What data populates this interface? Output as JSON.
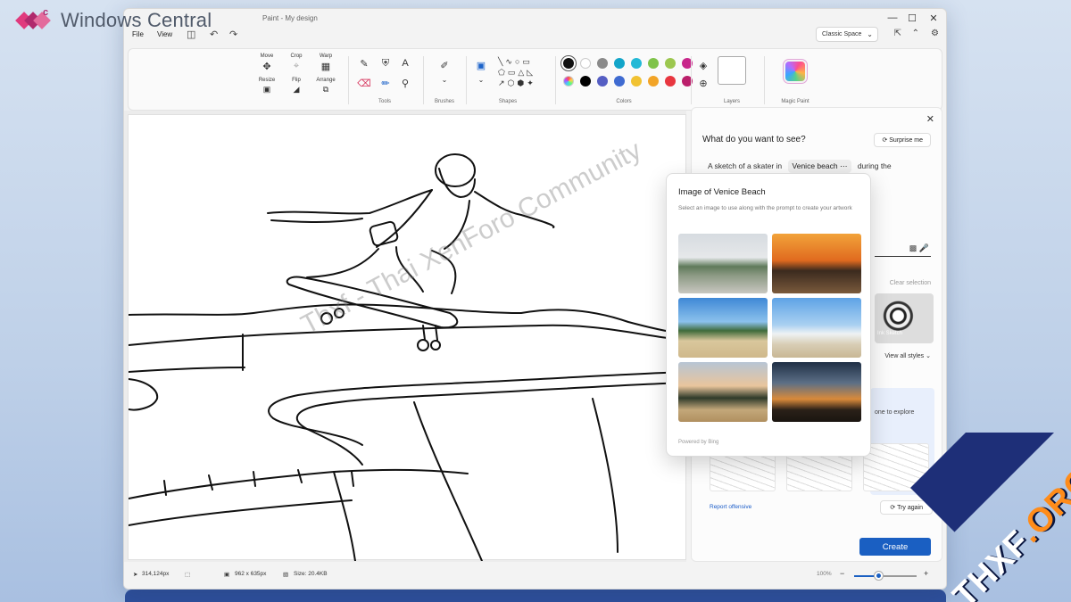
{
  "brand": {
    "name": "Windows Central"
  },
  "window": {
    "doc_title": "Paint - My design",
    "menu": [
      "File",
      "View"
    ],
    "space_select": "Classic Space",
    "controls": {
      "minimize": "—",
      "maximize": "☐",
      "close": "✕"
    }
  },
  "ribbon": {
    "image_tools": {
      "move": "Move",
      "crop": "Crop",
      "warp": "Warp",
      "resize": "Resize",
      "flip": "Flip",
      "arrange": "Arrange"
    },
    "groups": {
      "tools": "Tools",
      "brushes": "Brushes",
      "shapes": "Shapes",
      "colors": "Colors",
      "layers": "Layers",
      "magic_paint": "Magic Paint"
    },
    "colors": {
      "row1": [
        "#111111",
        "#ffffff",
        "#8a8a8a",
        "#13a5c9",
        "#23b9d6",
        "#7fc34a",
        "#9cc74f",
        "#c8268a"
      ],
      "row2": [
        "#ffffff",
        "#000000",
        "#555ec3",
        "#3f6bd1",
        "#f1c232",
        "#f2a427",
        "#e8363f",
        "#bb1f6b"
      ]
    }
  },
  "side_panel": {
    "heading": "What do you want to see?",
    "surprise_label": "Surprise me",
    "prompt_before": "A sketch of a skater in",
    "prompt_chip": "Venice beach",
    "prompt_after": "during the",
    "clear_selection": "Clear selection",
    "style_label": "Ink Sketch",
    "view_all_styles": "View all styles",
    "explore_text": "one to explore",
    "report_offensive": "Report offensive",
    "try_again": "Try again",
    "create": "Create"
  },
  "popup": {
    "title": "Image of Venice Beach",
    "description": "Select an image to use along with the prompt to create your artwork",
    "footer": "Powered by Bing"
  },
  "status": {
    "cursor": "314,124px",
    "canvas_size": "962 x 635px",
    "file_size": "Size: 20.4KB",
    "zoom": "100%",
    "zoom_minus": "−",
    "zoom_plus": "+",
    "zoom_level": 0.38
  },
  "watermark": "Thxf - Thai XenForo Community",
  "corner_badge": {
    "main": "THXF",
    "accent": ".ORG"
  }
}
